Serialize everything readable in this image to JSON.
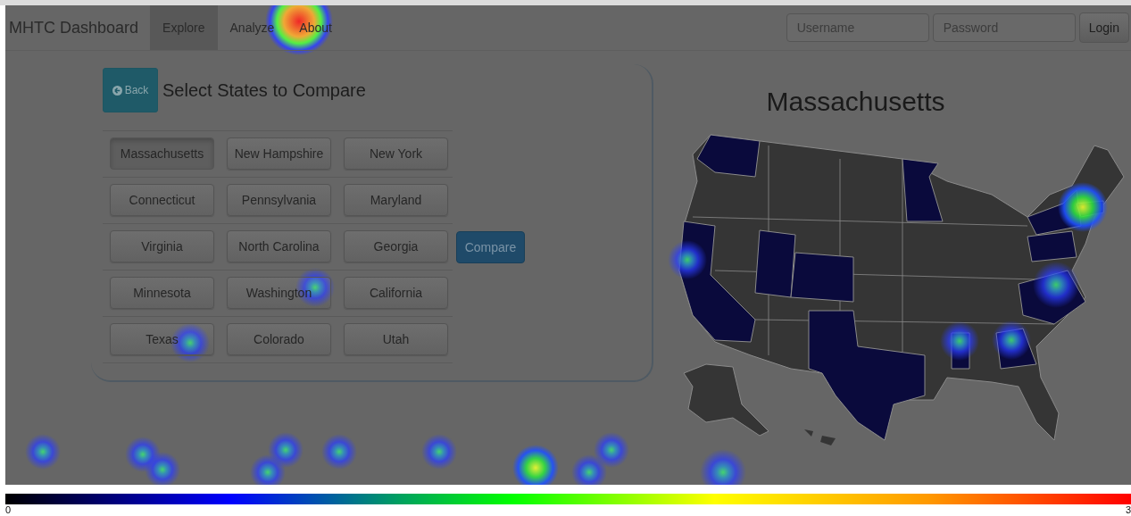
{
  "navbar": {
    "brand": "MHTC Dashboard",
    "tabs": [
      {
        "label": "Explore",
        "selected": true
      },
      {
        "label": "Analyze",
        "selected": false
      },
      {
        "label": "About",
        "selected": false
      }
    ],
    "username": {
      "placeholder": "Username"
    },
    "password": {
      "placeholder": "Password"
    },
    "login_button": "Login"
  },
  "picker": {
    "back_button": "Back",
    "title": "Select States to Compare",
    "compare_button": "Compare",
    "states": [
      {
        "label": "Massachusetts",
        "selected": true
      },
      {
        "label": "New Hampshire",
        "selected": false
      },
      {
        "label": "New York",
        "selected": false
      },
      {
        "label": "Connecticut",
        "selected": false
      },
      {
        "label": "Pennsylvania",
        "selected": false
      },
      {
        "label": "Maryland",
        "selected": false
      },
      {
        "label": "Virginia",
        "selected": false
      },
      {
        "label": "North Carolina",
        "selected": false
      },
      {
        "label": "Georgia",
        "selected": false
      },
      {
        "label": "Minnesota",
        "selected": false
      },
      {
        "label": "Washington",
        "selected": false
      },
      {
        "label": "California",
        "selected": false
      },
      {
        "label": "Texas",
        "selected": false
      },
      {
        "label": "Colorado",
        "selected": false
      },
      {
        "label": "Utah",
        "selected": false
      }
    ]
  },
  "map": {
    "title": "Massachusetts"
  },
  "legend": {
    "min_label": "0",
    "max_label": "3"
  }
}
